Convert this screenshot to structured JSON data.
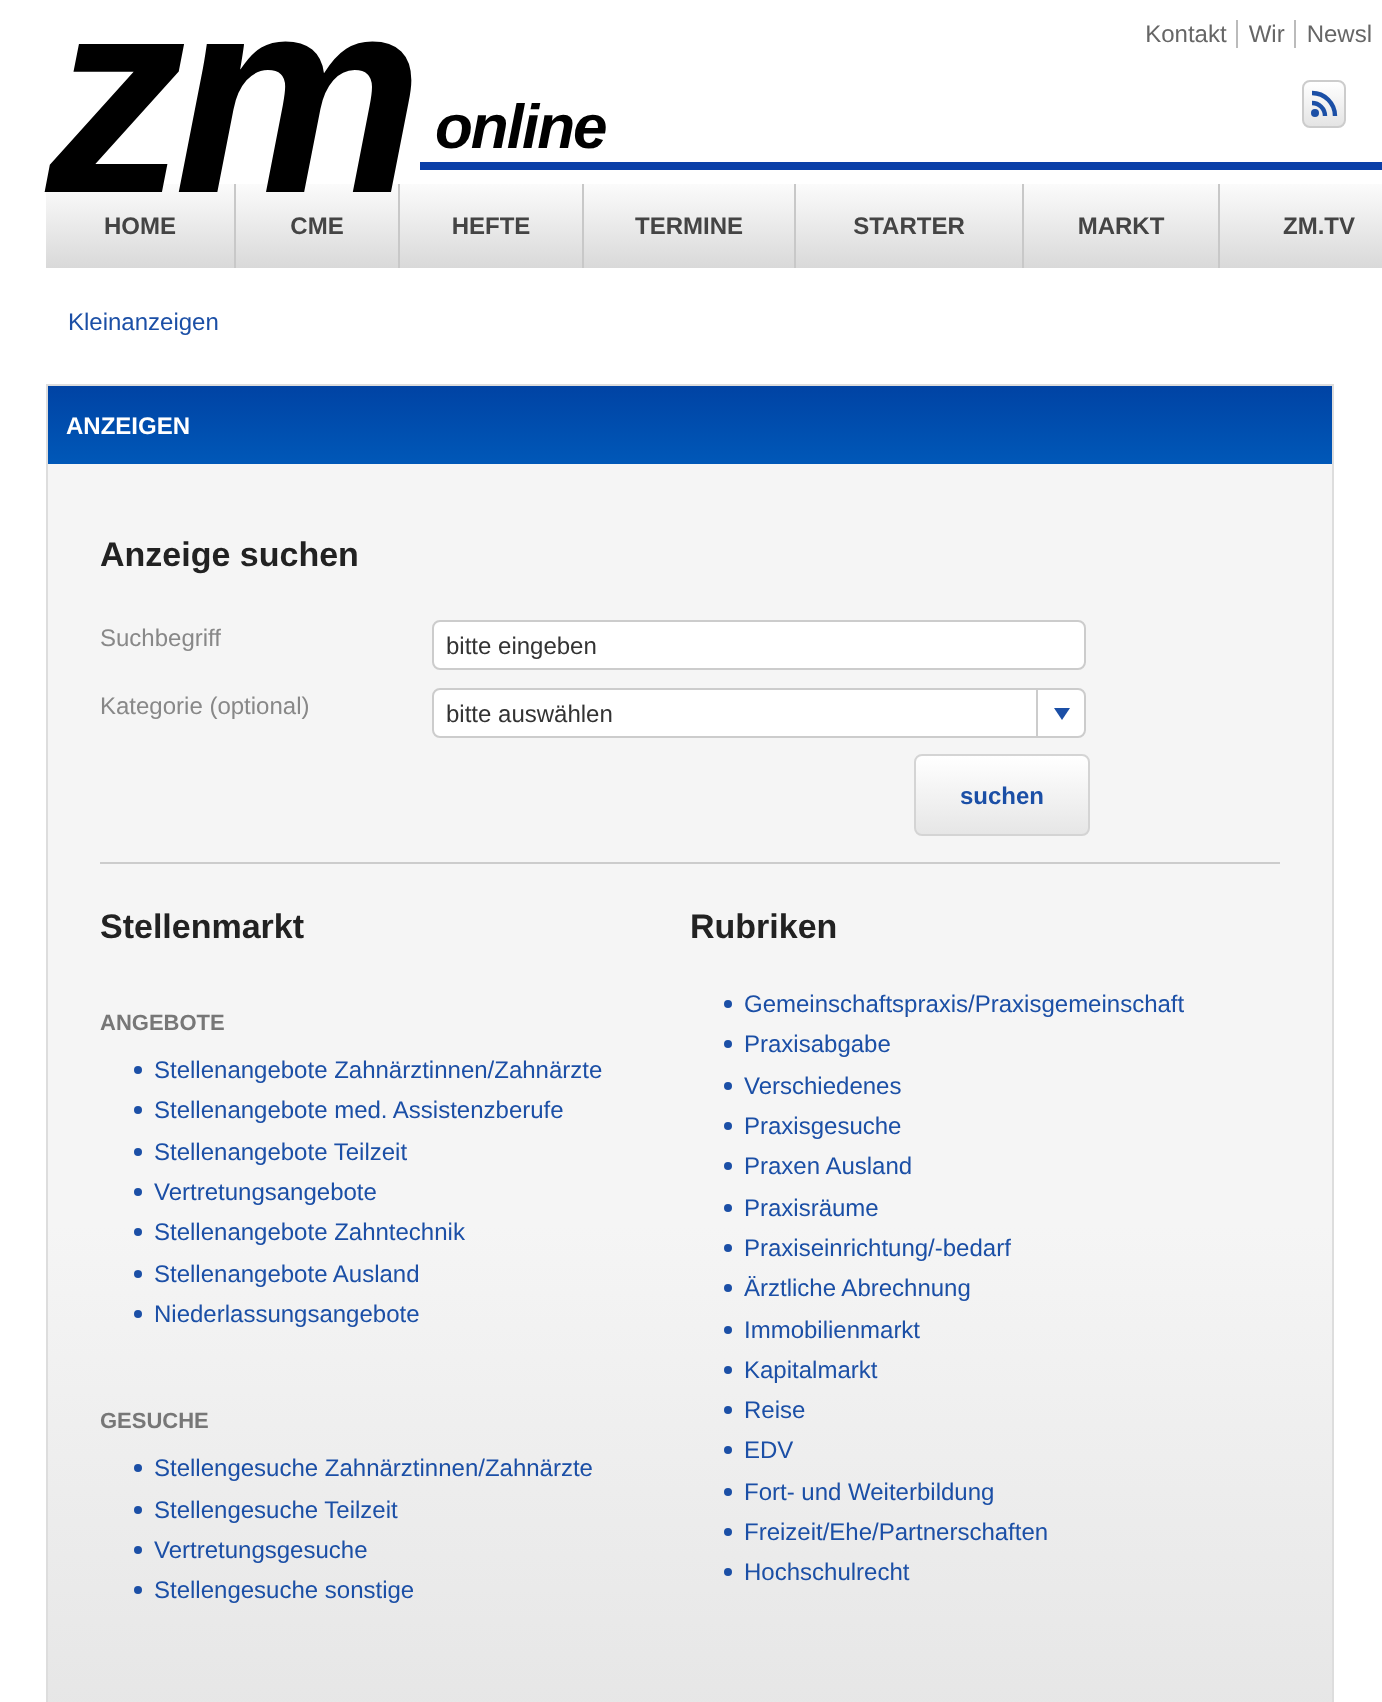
{
  "header": {
    "logo": {
      "mark": "zm",
      "suffix": "online"
    },
    "top_links": [
      "Kontakt",
      "Wir",
      "Newsl"
    ]
  },
  "nav": [
    {
      "label": "HOME"
    },
    {
      "label": "CME"
    },
    {
      "label": "HEFTE"
    },
    {
      "label": "TERMINE"
    },
    {
      "label": "STARTER"
    },
    {
      "label": "MARKT"
    },
    {
      "label": "ZM.TV"
    }
  ],
  "breadcrumb": "Kleinanzeigen",
  "panel": {
    "title": "ANZEIGEN",
    "search": {
      "heading": "Anzeige suchen",
      "fields": [
        {
          "kind": "text",
          "label": "Suchbegriff",
          "value": "bitte eingeben"
        },
        {
          "kind": "select",
          "label": "Kategorie (optional)",
          "value": "bitte auswählen"
        }
      ],
      "button": "suchen"
    },
    "stellenmarkt": {
      "heading": "Stellenmarkt",
      "groups": [
        {
          "label": "ANGEBOTE",
          "items": [
            "Stellenangebote Zahnärztinnen/Zahnärzte",
            "Stellenangebote med. Assistenzberufe",
            "Stellenangebote Teilzeit",
            "Vertretungsangebote",
            "Stellenangebote Zahntechnik",
            "Stellenangebote Ausland",
            "Niederlassungsangebote"
          ]
        },
        {
          "label": "GESUCHE",
          "items": [
            "Stellengesuche Zahnärztinnen/Zahnärzte",
            "Stellengesuche Teilzeit",
            "Vertretungsgesuche",
            "Stellengesuche sonstige"
          ]
        }
      ]
    },
    "rubriken": {
      "heading": "Rubriken",
      "items": [
        "Gemeinschaftspraxis/Praxisgemeinschaft",
        "Praxisabgabe",
        "Verschiedenes",
        "Praxisgesuche",
        "Praxen Ausland",
        "Praxisräume",
        "Praxiseinrichtung/-bedarf",
        "Ärztliche Abrechnung",
        "Immobilienmarkt",
        "Kapitalmarkt",
        "Reise",
        "EDV",
        "Fort- und Weiterbildung",
        "Freizeit/Ehe/Partnerschaften",
        "Hochschulrecht"
      ]
    }
  }
}
